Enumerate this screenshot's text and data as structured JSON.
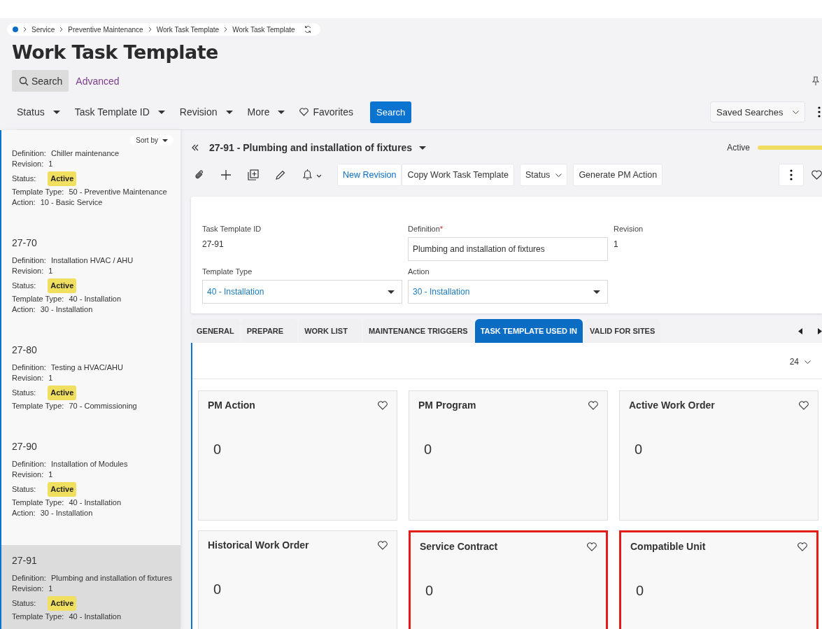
{
  "breadcrumb": [
    "Service",
    "Preventive Maintenance",
    "Work Task Template",
    "Work Task Template"
  ],
  "page_title": "Work Task Template",
  "search_modes": [
    {
      "label": "Search",
      "selected": true
    },
    {
      "label": "Advanced",
      "selected": false
    }
  ],
  "filters": [
    "Status",
    "Task Template ID",
    "Revision",
    "More"
  ],
  "favorites_label": "Favorites",
  "search_button": "Search",
  "saved_searches": "Saved Searches",
  "sort_label": "Sort by",
  "records": [
    {
      "selected": false,
      "fields": [
        {
          "label": "Definition:",
          "value": "Chiller maintenance"
        },
        {
          "label": "Revision:",
          "value": "1"
        },
        {
          "label": "Status:",
          "value": "Active",
          "kind": "badge"
        },
        {
          "label": "Template Type:",
          "value": "50 - Preventive Maintenance"
        },
        {
          "label": "Action:",
          "value": "10 - Basic Service"
        }
      ]
    },
    {
      "id": "27-70",
      "selected": false,
      "fields": [
        {
          "label": "Definition:",
          "value": "Installation HVAC / AHU"
        },
        {
          "label": "Revision:",
          "value": "1"
        },
        {
          "label": "Status:",
          "value": "Active",
          "kind": "badge"
        },
        {
          "label": "Template Type:",
          "value": "40 - Installation"
        },
        {
          "label": "Action:",
          "value": "30 - Installation"
        }
      ]
    },
    {
      "id": "27-80",
      "selected": false,
      "fields": [
        {
          "label": "Definition:",
          "value": "Testing a HVAC/AHU"
        },
        {
          "label": "Revision:",
          "value": "1"
        },
        {
          "label": "Status:",
          "value": "Active",
          "kind": "badge"
        },
        {
          "label": "Template Type:",
          "value": "70 - Commissioning"
        }
      ]
    },
    {
      "id": "27-90",
      "selected": false,
      "fields": [
        {
          "label": "Definition:",
          "value": "Installation of Modules"
        },
        {
          "label": "Revision:",
          "value": "1"
        },
        {
          "label": "Status:",
          "value": "Active",
          "kind": "badge"
        },
        {
          "label": "Template Type:",
          "value": "40 - Installation"
        },
        {
          "label": "Action:",
          "value": "30 - Installation"
        }
      ]
    },
    {
      "id": "27-91",
      "selected": true,
      "fields": [
        {
          "label": "Definition:",
          "value": "Plumbing and installation of fixtures"
        },
        {
          "label": "Revision:",
          "value": "1"
        },
        {
          "label": "Status:",
          "value": "Active",
          "kind": "badge"
        },
        {
          "label": "Template Type:",
          "value": "40 - Installation"
        }
      ]
    }
  ],
  "record_title": "27-91 - Plumbing and installation of fixtures",
  "record_status": "Active",
  "record_progress": {
    "level": 1
  },
  "actions": [
    {
      "label": "New Revision",
      "kind": "link"
    },
    {
      "label": "Copy Work Task Template",
      "kind": "plain"
    },
    {
      "label": "Status",
      "kind": "menu"
    },
    {
      "label": "Generate PM Action",
      "kind": "plain"
    }
  ],
  "form": [
    {
      "label": "Task Template ID",
      "value": "27-91",
      "kind": "text"
    },
    {
      "label": "Definition",
      "value": "Plumbing and installation of fixtures",
      "kind": "input",
      "required_mark": "*"
    },
    {
      "label": "Revision",
      "value": "1",
      "kind": "text"
    },
    {
      "label": "Template Type",
      "value": "40 - Installation",
      "kind": "select"
    },
    {
      "label": "Action",
      "value": "30 - Installation",
      "kind": "select"
    }
  ],
  "tabs": [
    {
      "label": "GENERAL",
      "selected": false
    },
    {
      "label": "PREPARE",
      "selected": false
    },
    {
      "label": "WORK LIST",
      "selected": false
    },
    {
      "label": "MAINTENANCE TRIGGERS",
      "selected": false
    },
    {
      "label": "TASK TEMPLATE USED IN",
      "selected": true
    },
    {
      "label": "VALID FOR SITES",
      "selected": false
    }
  ],
  "page_size": "24",
  "tiles": [
    {
      "title": "PM Action",
      "count": "0",
      "highlighted": false
    },
    {
      "title": "PM Program",
      "count": "0",
      "highlighted": false
    },
    {
      "title": "Active Work Order",
      "count": "0",
      "highlighted": false
    },
    {
      "title": "Historical Work Order",
      "count": "0",
      "highlighted": false
    },
    {
      "title": "Service Contract",
      "count": "0",
      "highlighted": true
    },
    {
      "title": "Compatible Unit",
      "count": "0",
      "highlighted": true
    }
  ]
}
